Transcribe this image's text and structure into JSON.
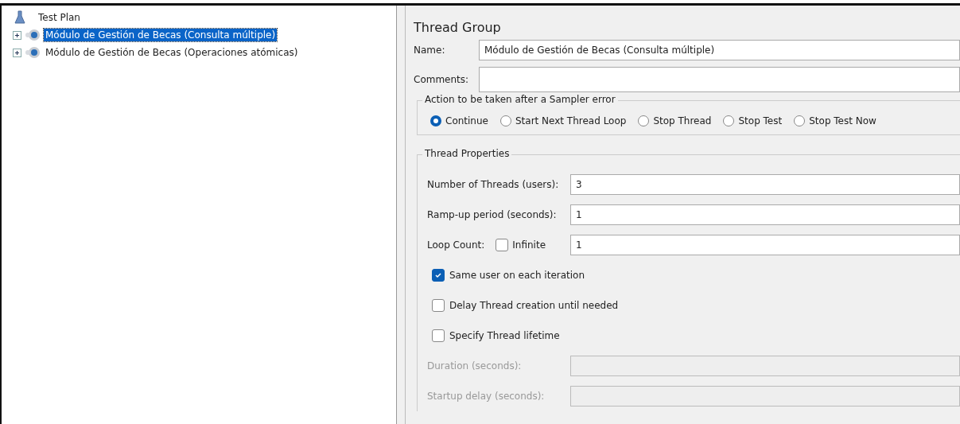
{
  "tree": {
    "root": "Test Plan",
    "children": [
      {
        "label": "Módulo de Gestión de Becas (Consulta múltiple)",
        "selected": true,
        "expanded": false
      },
      {
        "label": "Módulo de Gestión de Becas (Operaciones atómicas)",
        "selected": false,
        "expanded": false
      }
    ]
  },
  "panel": {
    "title": "Thread Group",
    "name_field": {
      "label": "Name:",
      "value": "Módulo de Gestión de Becas (Consulta múltiple)"
    },
    "comments_field": {
      "label": "Comments:"
    },
    "error_action": {
      "legend": "Action to be taken after a Sampler error",
      "options": [
        {
          "label": "Continue",
          "selected": true
        },
        {
          "label": "Start Next Thread Loop",
          "selected": false
        },
        {
          "label": "Stop Thread",
          "selected": false
        },
        {
          "label": "Stop Test",
          "selected": false
        },
        {
          "label": "Stop Test Now",
          "selected": false
        }
      ]
    },
    "thread_properties": {
      "legend": "Thread Properties",
      "rows": [
        {
          "kind": "field",
          "label": "Number of Threads (users):",
          "value": "3",
          "disabled": false
        },
        {
          "kind": "field",
          "label": "Ramp-up period (seconds):",
          "value": "1",
          "disabled": false
        },
        {
          "kind": "loop",
          "label": "Loop Count:",
          "checkbox_label": "Infinite",
          "checked": false,
          "value": "1"
        },
        {
          "kind": "checkbox",
          "label": "Same user on each iteration",
          "checked": true
        },
        {
          "kind": "checkbox",
          "label": "Delay Thread creation until needed",
          "checked": false
        },
        {
          "kind": "checkbox",
          "label": "Specify Thread lifetime",
          "checked": false
        },
        {
          "kind": "field",
          "label": "Duration (seconds):",
          "disabled": true
        },
        {
          "kind": "field",
          "label": "Startup delay (seconds):",
          "disabled": true
        }
      ]
    }
  }
}
